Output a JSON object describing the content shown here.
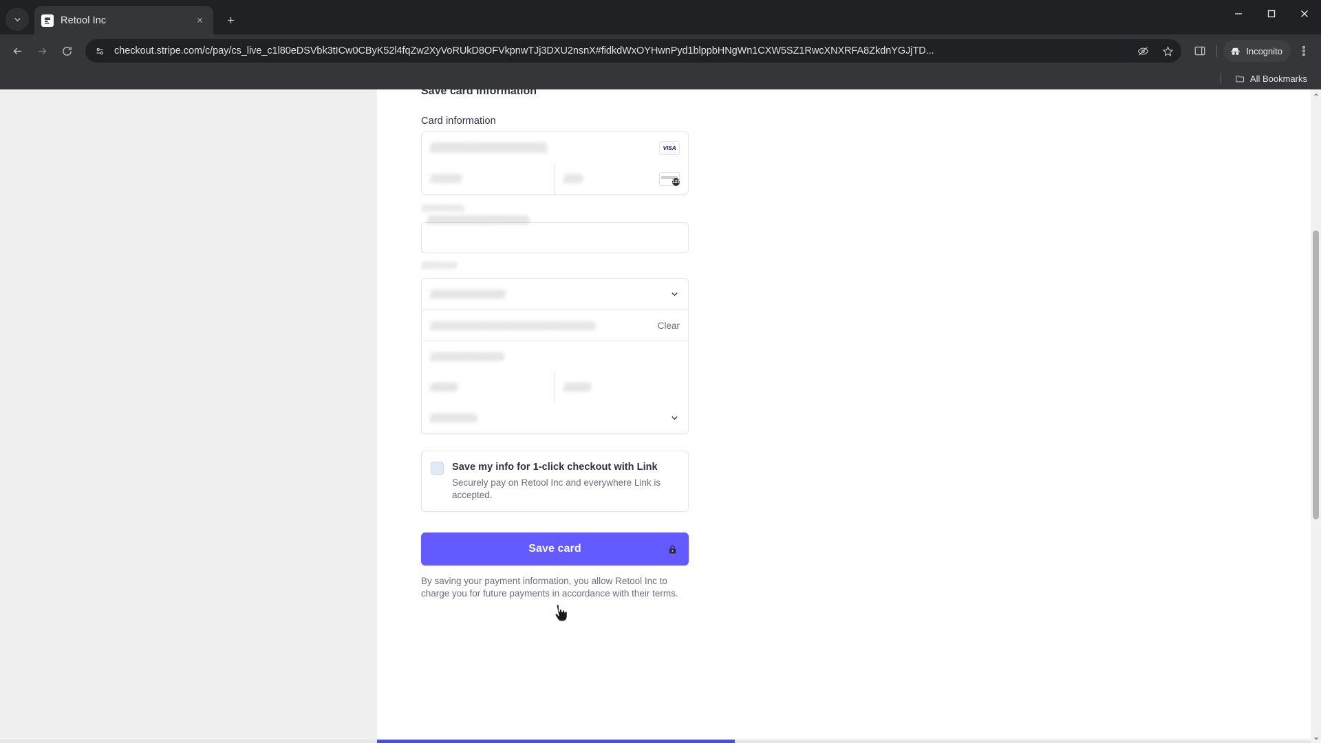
{
  "browser": {
    "window_controls": {
      "minimize": "minimize-icon",
      "maximize": "maximize-icon",
      "close": "close-icon"
    },
    "tab_search_icon": "chevron-down-icon",
    "new_tab_icon": "plus-icon",
    "tabs": [
      {
        "title": "Retool Inc",
        "favicon": "retool-favicon",
        "close_icon": "close-icon",
        "active": true
      }
    ],
    "toolbar": {
      "back_icon": "arrow-back-icon",
      "forward_icon": "arrow-forward-icon",
      "reload_icon": "reload-icon",
      "site_info_icon": "site-settings-icon",
      "url": "checkout.stripe.com/c/pay/cs_live_c1l80eDSVbk3tICw0CByK52l4fqZw2XyVoRUkD8OFVkpnwTJj3DXU2nsnX#fidkdWxOYHwnPyd1blppbHNgWn1CXW5SZ1RwcXNXRFA8ZkdnYGJjTD...",
      "tracking_protection_icon": "eye-crossed-icon",
      "bookmark_icon": "star-icon",
      "side_panel_icon": "side-panel-icon",
      "incognito_label": "Incognito",
      "incognito_icon": "incognito-hat-icon",
      "menu_icon": "three-dot-menu-icon"
    },
    "bookmarks_bar": {
      "all_bookmarks_label": "All Bookmarks",
      "folder_icon": "folder-icon"
    }
  },
  "page": {
    "clipped_heading": "Save card information",
    "card_information_label": "Card information",
    "card_number_placeholder_redacted": true,
    "brand_badges": {
      "visa_label": "VISA",
      "cvc_icon": "cvc-card-icon",
      "cvc_digits": "123"
    },
    "clear_button_label": "Clear",
    "link_box": {
      "checkbox_state": "unchecked",
      "title": "Save my info for 1-click checkout with Link",
      "subtitle": "Securely pay on Retool Inc and everywhere Link is accepted."
    },
    "submit": {
      "label": "Save card",
      "lock_icon": "lock-icon",
      "color": "#635bff"
    },
    "legal_text": "By saving your payment information, you allow Retool Inc to charge you for future payments in accordance with their terms.",
    "chevron_icon": "chevron-down-icon",
    "scrollbar": {
      "up_icon": "caret-up-icon",
      "down_icon": "caret-down-icon"
    }
  }
}
